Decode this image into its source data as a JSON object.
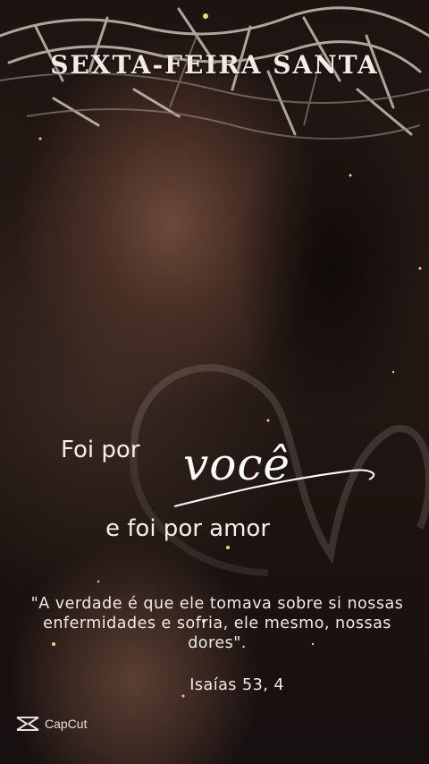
{
  "title": "SEXTA-FEIRA SANTA",
  "message": {
    "line1": "Foi por",
    "highlight": "você",
    "line2": "e foi por amor"
  },
  "verse": {
    "text": "\"A verdade é que ele tomava sobre si nossas enfermidades e sofria, ele mesmo, nossas dores\".",
    "reference": "Isaías 53, 4"
  },
  "watermark": {
    "icon": "capcut-logo-icon",
    "label": "CapCut"
  },
  "colors": {
    "text": "#f6f0ea",
    "sparkle": "#f4d27a"
  }
}
